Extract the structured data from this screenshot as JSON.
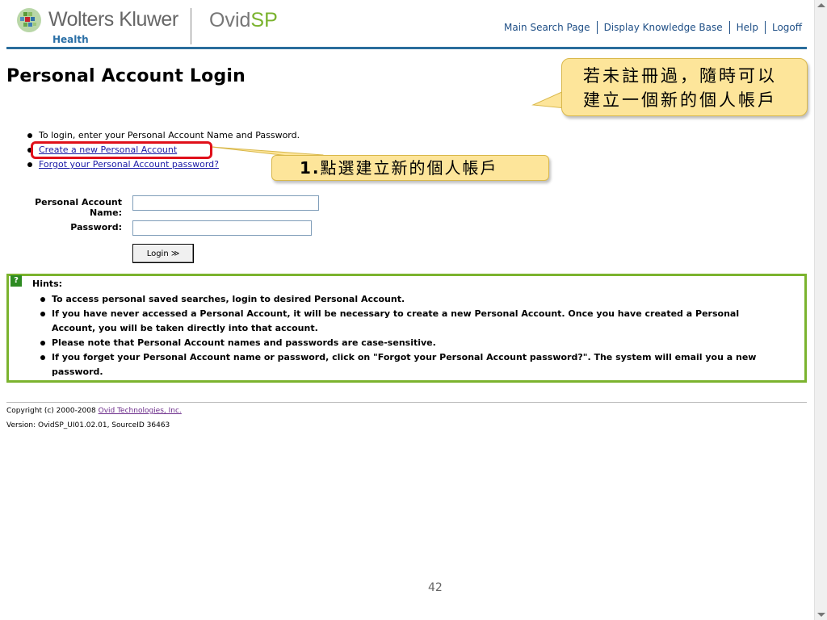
{
  "header": {
    "brand": "Wolters Kluwer",
    "brand_sub": "Health",
    "product_ovid": "Ovid",
    "product_sp": "SP",
    "nav": [
      "Main Search Page",
      "Display Knowledge Base",
      "Help",
      "Logoff"
    ]
  },
  "page": {
    "title": "Personal Account Login"
  },
  "instructions": {
    "line1": "To login, enter your Personal Account Name and Password.",
    "create_link": "Create a new Personal Account",
    "forgot_link": "Forgot your Personal Account password?"
  },
  "callouts": {
    "step1_number": "1.",
    "step1_text": "點選建立新的個人帳戶",
    "side_line1": "若未註冊過，隨時可以",
    "side_line2": "建立一個新的個人帳戶"
  },
  "form": {
    "name_label": "Personal Account Name:",
    "name_value": "",
    "password_label": "Password:",
    "password_value": "",
    "login_button": "Login ≫"
  },
  "hints": {
    "icon": "?",
    "title": "Hints:",
    "items": [
      "To access personal saved searches, login to desired Personal Account.",
      "If you have never accessed a Personal Account, it will be necessary to create a new Personal Account. Once you have created a Personal Account, you will be taken directly into that account.",
      "Please note that Personal Account names and passwords are case-sensitive.",
      "If you forget your Personal Account name or password, click on \"Forgot your Personal Account password?\". The system will email you a new password."
    ]
  },
  "footer": {
    "copyright_prefix": "Copyright (c) 2000-2008",
    "company_link": "Ovid Technologies, Inc.",
    "version": "Version: OvidSP_UI01.02.01, SourceID 36463"
  },
  "slide_page_number": "42",
  "colors": {
    "header_line": "#2a6d9c",
    "hints_border": "#7bb32e",
    "callout_fill": "#fde59a",
    "highlight_red": "#e0101a"
  }
}
